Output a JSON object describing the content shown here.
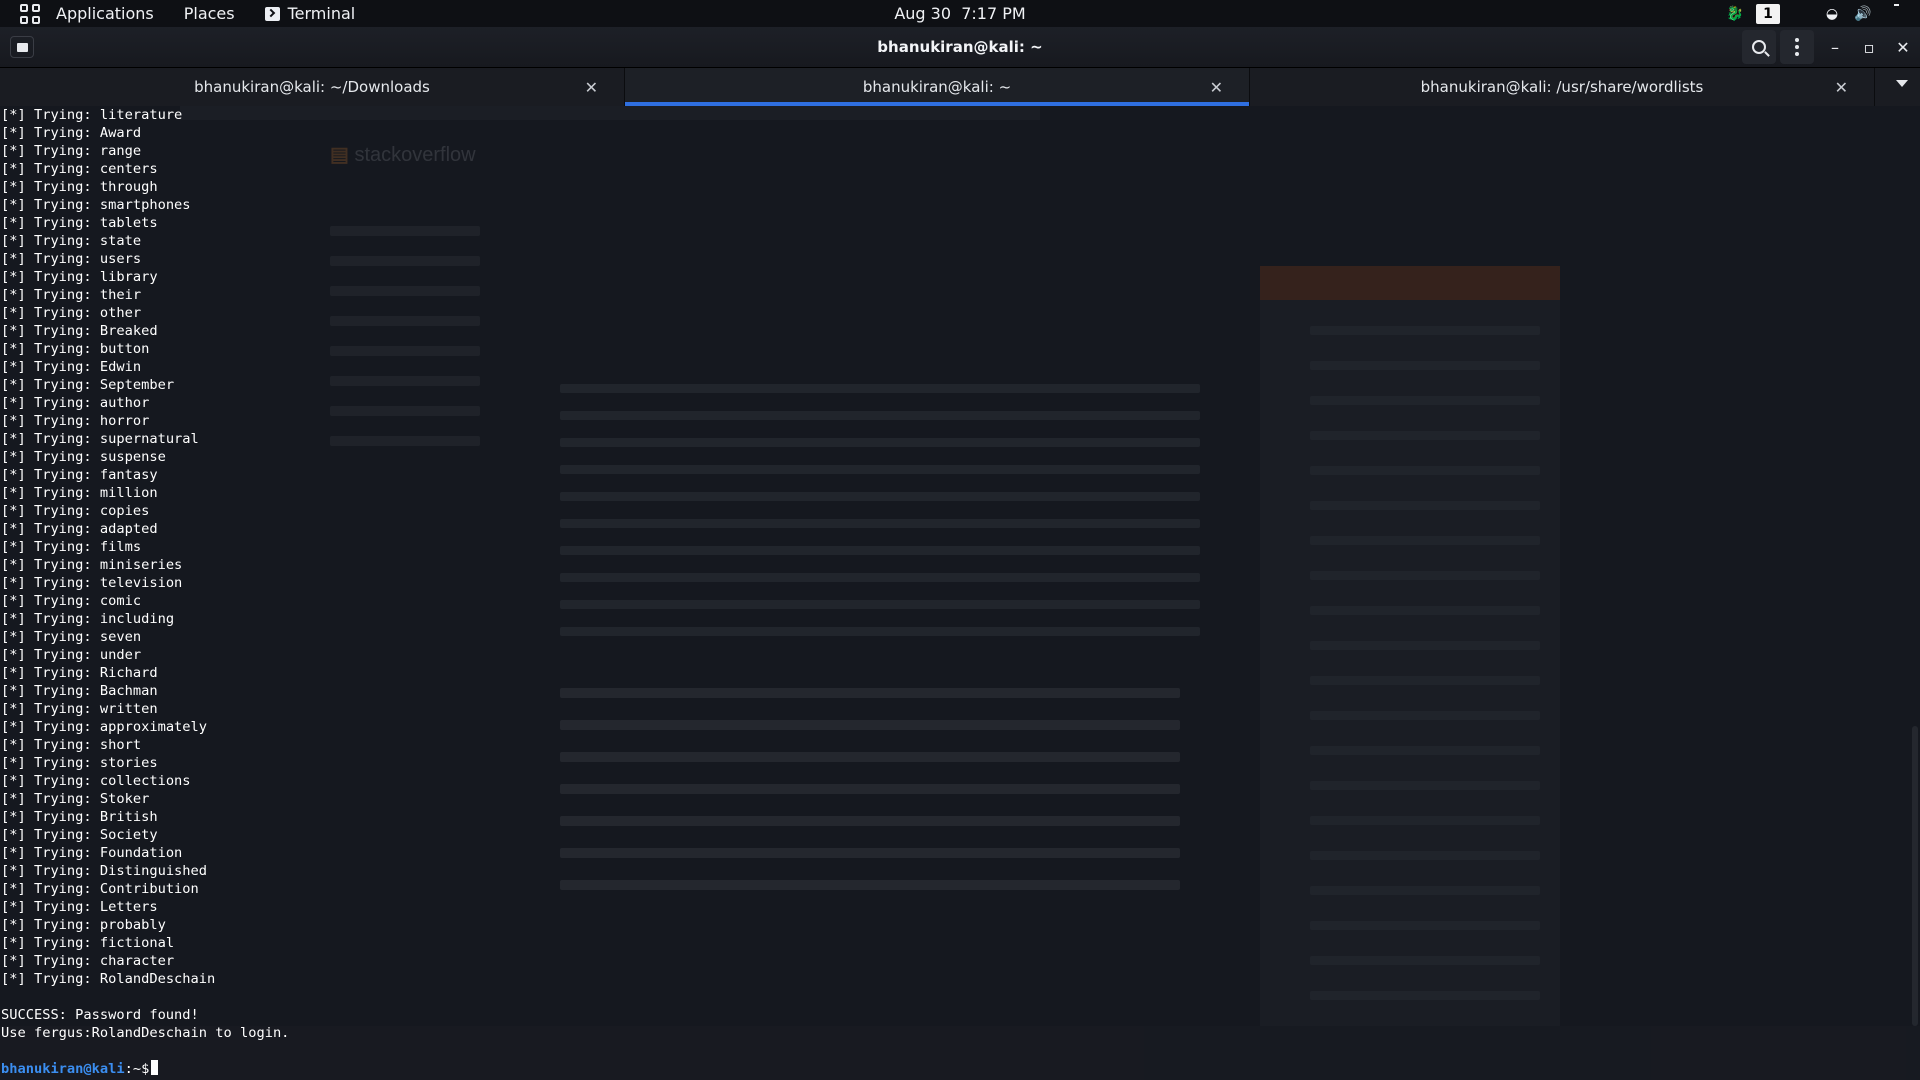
{
  "topbar": {
    "applications": "Applications",
    "places": "Places",
    "terminal": "Terminal",
    "date": "Aug 30",
    "time": "7:17 PM",
    "workspace": "1"
  },
  "window": {
    "title": "bhanukiran@kali: ~"
  },
  "tabs": [
    {
      "label": "bhanukiran@kali: ~/Downloads"
    },
    {
      "label": "bhanukiran@kali: ~"
    },
    {
      "label": "bhanukiran@kali: /usr/share/wordlists"
    }
  ],
  "terminal": {
    "prefix": "[*] Trying: ",
    "tries": [
      "literature",
      "Award",
      "range",
      "centers",
      "through",
      "smartphones",
      "tablets",
      "state",
      "users",
      "library",
      "their",
      "other",
      "Breaked",
      "button",
      "Edwin",
      "September",
      "author",
      "horror",
      "supernatural",
      "suspense",
      "fantasy",
      "million",
      "copies",
      "adapted",
      "films",
      "miniseries",
      "television",
      "comic",
      "including",
      "seven",
      "under",
      "Richard",
      "Bachman",
      "written",
      "approximately",
      "short",
      "stories",
      "collections",
      "Stoker",
      "British",
      "Society",
      "Foundation",
      "Distinguished",
      "Contribution",
      "Letters",
      "probably",
      "fictional",
      "character",
      "RolandDeschain"
    ],
    "success": "SUCCESS: Password found!",
    "use_line": "Use fergus:RolandDeschain to login.",
    "prompt_user": "bhanukiran@kali",
    "prompt_path": ":~$"
  },
  "colors": {
    "accent": "#2f6fe0",
    "prompt": "#3b8ef0",
    "background": "#15181f"
  }
}
